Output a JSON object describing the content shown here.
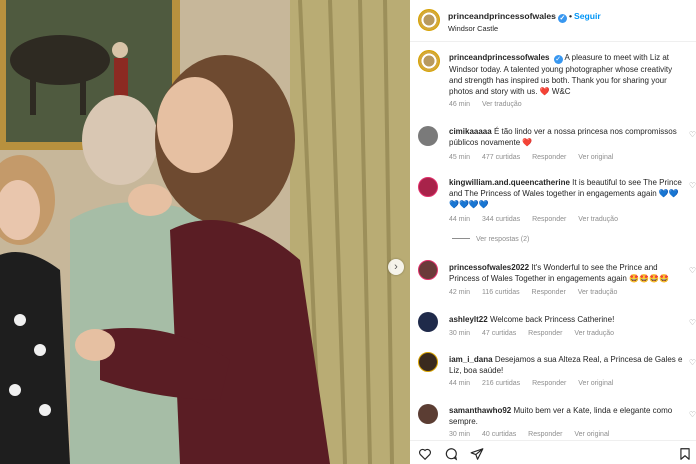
{
  "header": {
    "username": "princeandprincessofwales",
    "follow_label": "Seguir",
    "location": "Windsor Castle"
  },
  "caption": {
    "username": "princeandprincessofwales",
    "text": "A pleasure to meet with Liz at Windsor today. A talented young photographer whose creativity and strength has inspired us both. Thank you for sharing your photos and story with us. ❤️ W&C",
    "time": "46 min",
    "translate": "Ver tradução"
  },
  "comments": [
    {
      "username": "cimikaaaaa",
      "text": "É tão lindo ver a nossa princesa nos compromissos públicos novamente ❤️",
      "time": "45 min",
      "likes": "477 curtidas",
      "reply": "Responder",
      "action": "Ver original"
    },
    {
      "username": "kingwilliam.and.queencatherine",
      "text": "It is beautiful to see The Prince and The Princess of Wales together in engagements again 💙💙💙💙💙💙",
      "time": "44 min",
      "likes": "344 curtidas",
      "reply": "Responder",
      "action": "Ver tradução",
      "view_replies": "Ver respostas (2)"
    },
    {
      "username": "princessofwales2022",
      "text": "It's Wonderful to see the Prince and Princess of Wales Together in engagements again 🤩🤩🤩🤩",
      "time": "42 min",
      "likes": "116 curtidas",
      "reply": "Responder",
      "action": "Ver tradução"
    },
    {
      "username": "ashleylt22",
      "text": "Welcome back Princess Catherine!",
      "time": "30 min",
      "likes": "47 curtidas",
      "reply": "Responder",
      "action": "Ver tradução"
    },
    {
      "username": "iam_i_dana",
      "text": "Desejamos a sua Alteza Real, a Princesa de Gales e Liz, boa saúde!",
      "time": "44 min",
      "likes": "216 curtidas",
      "reply": "Responder",
      "action": "Ver original"
    },
    {
      "username": "samanthawho92",
      "text": "Muito bem ver a Kate, linda e elegante como sempre.",
      "time": "30 min",
      "likes": "40 curtidas",
      "reply": "Responder",
      "action": "Ver original"
    }
  ],
  "icons": [
    "verified-icon",
    "heart-icon",
    "comment-icon",
    "share-icon",
    "save-icon",
    "carousel-next-icon"
  ],
  "colors": {
    "accent": "#0095f6",
    "verified": "#3897f0",
    "meta": "#8e8e8e"
  }
}
